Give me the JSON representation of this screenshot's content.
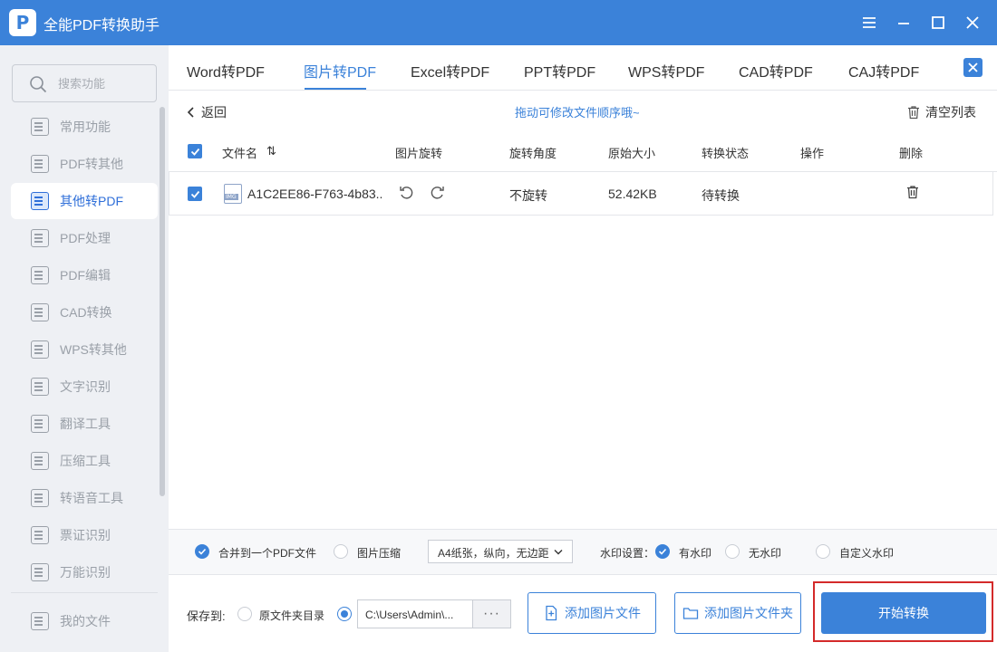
{
  "app": {
    "title": "全能PDF转换助手"
  },
  "search": {
    "placeholder": "搜索功能"
  },
  "sidebar": {
    "items": [
      {
        "label": "常用功能"
      },
      {
        "label": "PDF转其他"
      },
      {
        "label": "其他转PDF",
        "active": true
      },
      {
        "label": "PDF处理"
      },
      {
        "label": "PDF编辑"
      },
      {
        "label": "CAD转换"
      },
      {
        "label": "WPS转其他"
      },
      {
        "label": "文字识别"
      },
      {
        "label": "翻译工具"
      },
      {
        "label": "压缩工具"
      },
      {
        "label": "转语音工具"
      },
      {
        "label": "票证识别"
      },
      {
        "label": "万能识别"
      }
    ],
    "my_files": "我的文件"
  },
  "tabs": [
    {
      "label": "Word转PDF"
    },
    {
      "label": "图片转PDF",
      "active": true
    },
    {
      "label": "Excel转PDF"
    },
    {
      "label": "PPT转PDF"
    },
    {
      "label": "WPS转PDF"
    },
    {
      "label": "CAD转PDF"
    },
    {
      "label": "CAJ转PDF"
    }
  ],
  "toolbar": {
    "back_label": "返回",
    "hint": "拖动可修改文件顺序哦~",
    "clear_label": "清空列表"
  },
  "table": {
    "headers": {
      "filename": "文件名",
      "sort": "⇅",
      "rotate": "图片旋转",
      "angle": "旋转角度",
      "size": "原始大小",
      "status": "转换状态",
      "action": "操作",
      "delete": "删除"
    },
    "rows": [
      {
        "checked": true,
        "file_type": "IMG",
        "filename": "A1C2EE86-F763-4b83..",
        "angle": "不旋转",
        "size": "52.42KB",
        "status": "待转换"
      }
    ]
  },
  "options": {
    "merge_label": "合并到一个PDF文件",
    "merge_checked": true,
    "compress_label": "图片压缩",
    "compress_checked": false,
    "page_setting": "A4纸张，纵向，无边距",
    "watermark_label": "水印设置：",
    "watermark_options": [
      {
        "label": "有水印",
        "selected": true
      },
      {
        "label": "无水印",
        "selected": false
      },
      {
        "label": "自定义水印",
        "selected": false
      }
    ]
  },
  "save": {
    "label": "保存到:",
    "source_dir_label": "原文件夹目录",
    "source_dir_selected": false,
    "path": "C:\\Users\\Admin\\...",
    "more_label": "···"
  },
  "buttons": {
    "add_files": "添加图片文件",
    "add_folder": "添加图片文件夹",
    "start": "开始转换"
  },
  "colors": {
    "primary": "#3b82d9",
    "sidebar_bg": "#eef0f4",
    "highlight": "#d42a2a"
  }
}
